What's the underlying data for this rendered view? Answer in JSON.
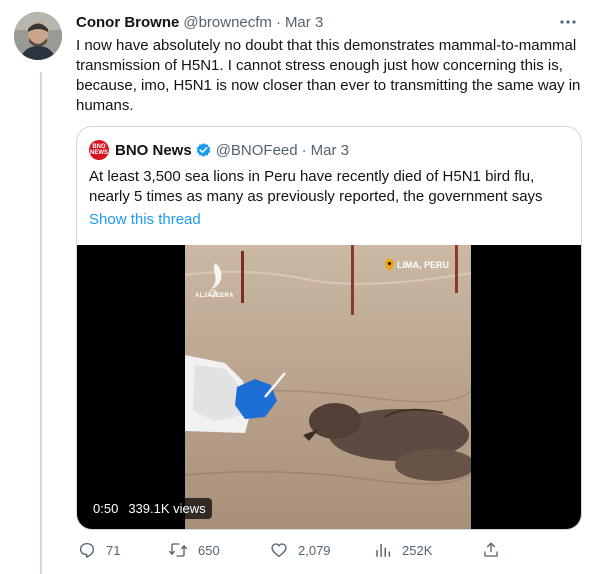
{
  "tweet": {
    "author_name": "Conor Browne",
    "author_handle": "@brownecfm",
    "separator": "·",
    "date": "Mar 3",
    "text": "I now have absolutely no doubt that this demonstrates mammal-to-mammal transmission of H5N1. I cannot stress enough just how concerning this is, because, imo, H5N1 is now closer than ever to transmitting the same way in humans.",
    "more_icon": "more-horizontal-icon"
  },
  "quoted_tweet": {
    "logo_top": "BNO",
    "logo_bottom": "NEWS",
    "author_name": "BNO News",
    "verified_icon": "verified-badge-icon",
    "author_handle": "@BNOFeed",
    "separator": "·",
    "date": "Mar 3",
    "text": "At least 3,500 sea lions in Peru have recently died of H5N1 bird flu, nearly 5 times as many as previously reported, the government says",
    "show_thread": "Show this thread"
  },
  "video": {
    "brand_caption": "ALJAZEERA",
    "location": "LIMA, PERU",
    "duration": "0:50",
    "views": "339.1K views"
  },
  "actions": {
    "reply": {
      "icon": "reply-icon",
      "count": "71"
    },
    "retweet": {
      "icon": "retweet-icon",
      "count": "650"
    },
    "like": {
      "icon": "heart-icon",
      "count": "2,079"
    },
    "views": {
      "icon": "analytics-icon",
      "count": "252K"
    },
    "share": {
      "icon": "share-icon"
    }
  },
  "colors": {
    "text_primary": "#0f1419",
    "text_secondary": "#536471",
    "link": "#1d9bf0",
    "border": "#cfd9de",
    "bno_red": "#d4141f",
    "location_pin": "#f5a300"
  }
}
